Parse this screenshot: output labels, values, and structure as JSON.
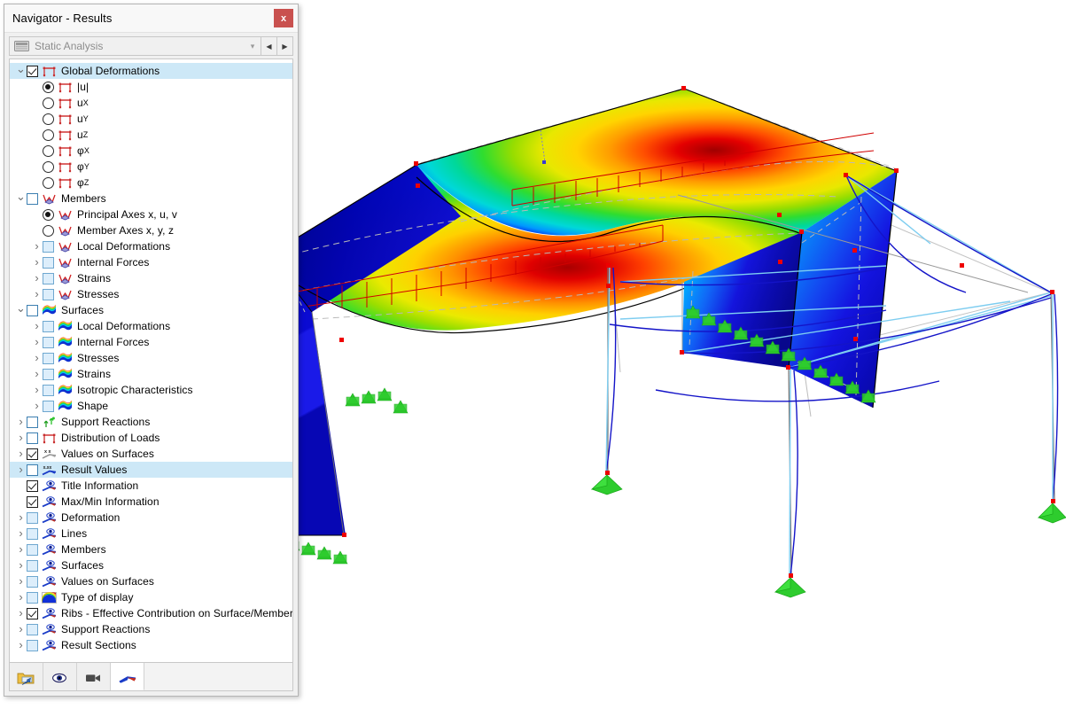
{
  "window": {
    "title": "Navigator - Results",
    "close_label": "x",
    "close_icon": "close-icon"
  },
  "combo": {
    "value": "Static Analysis",
    "icon": "analysis-type-icon",
    "dropdown_icon": "chevron-down-icon",
    "prev_label": "◀",
    "next_label": "▶"
  },
  "tree": [
    {
      "label": "Global Deformations",
      "depth": 0,
      "twisty": "expanded",
      "control": "checkbox",
      "state": "checked",
      "icon": "frame-icon",
      "selected": true
    },
    {
      "label": "|u|",
      "depth": 1,
      "twisty": "none",
      "control": "radio",
      "state": "checked",
      "icon": "frame-icon",
      "selected": false
    },
    {
      "label": "u",
      "sub": "X",
      "depth": 1,
      "twisty": "none",
      "control": "radio",
      "state": "unchecked",
      "icon": "frame-icon",
      "selected": false
    },
    {
      "label": "u",
      "sub": "Y",
      "depth": 1,
      "twisty": "none",
      "control": "radio",
      "state": "unchecked",
      "icon": "frame-icon",
      "selected": false
    },
    {
      "label": "u",
      "sub": "Z",
      "depth": 1,
      "twisty": "none",
      "control": "radio",
      "state": "unchecked",
      "icon": "frame-icon",
      "selected": false
    },
    {
      "label": "φ",
      "sub": "X",
      "depth": 1,
      "twisty": "none",
      "control": "radio",
      "state": "unchecked",
      "icon": "frame-icon",
      "selected": false
    },
    {
      "label": "φ",
      "sub": "Y",
      "depth": 1,
      "twisty": "none",
      "control": "radio",
      "state": "unchecked",
      "icon": "frame-icon",
      "selected": false
    },
    {
      "label": "φ",
      "sub": "Z",
      "depth": 1,
      "twisty": "none",
      "control": "radio",
      "state": "unchecked",
      "icon": "frame-icon",
      "selected": false
    },
    {
      "label": "Members",
      "depth": 0,
      "twisty": "expanded",
      "control": "checkbox",
      "state": "unchecked",
      "icon": "member-diagram-icon",
      "selected": false
    },
    {
      "label": "Principal Axes x, u, v",
      "depth": 1,
      "twisty": "none",
      "control": "radio",
      "state": "checked",
      "icon": "member-diagram-icon",
      "selected": false
    },
    {
      "label": "Member Axes x, y, z",
      "depth": 1,
      "twisty": "none",
      "control": "radio",
      "state": "unchecked",
      "icon": "member-diagram-icon",
      "selected": false
    },
    {
      "label": "Local Deformations",
      "depth": 1,
      "twisty": "collapsed",
      "control": "checkbox",
      "state": "light",
      "icon": "member-diagram-icon",
      "selected": false
    },
    {
      "label": "Internal Forces",
      "depth": 1,
      "twisty": "collapsed",
      "control": "checkbox",
      "state": "light",
      "icon": "member-diagram-icon",
      "selected": false
    },
    {
      "label": "Strains",
      "depth": 1,
      "twisty": "collapsed",
      "control": "checkbox",
      "state": "light",
      "icon": "member-diagram-icon",
      "selected": false
    },
    {
      "label": "Stresses",
      "depth": 1,
      "twisty": "collapsed",
      "control": "checkbox",
      "state": "light",
      "icon": "member-diagram-icon",
      "selected": false
    },
    {
      "label": "Surfaces",
      "depth": 0,
      "twisty": "expanded",
      "control": "checkbox",
      "state": "unchecked",
      "icon": "surface-contour-icon",
      "selected": false
    },
    {
      "label": "Local Deformations",
      "depth": 1,
      "twisty": "collapsed",
      "control": "checkbox",
      "state": "light",
      "icon": "surface-contour-icon",
      "selected": false
    },
    {
      "label": "Internal Forces",
      "depth": 1,
      "twisty": "collapsed",
      "control": "checkbox",
      "state": "light",
      "icon": "surface-contour-icon",
      "selected": false
    },
    {
      "label": "Stresses",
      "depth": 1,
      "twisty": "collapsed",
      "control": "checkbox",
      "state": "light",
      "icon": "surface-contour-icon",
      "selected": false
    },
    {
      "label": "Strains",
      "depth": 1,
      "twisty": "collapsed",
      "control": "checkbox",
      "state": "light",
      "icon": "surface-contour-icon",
      "selected": false
    },
    {
      "label": "Isotropic Characteristics",
      "depth": 1,
      "twisty": "collapsed",
      "control": "checkbox",
      "state": "light",
      "icon": "surface-contour-icon",
      "selected": false
    },
    {
      "label": "Shape",
      "depth": 1,
      "twisty": "collapsed",
      "control": "checkbox",
      "state": "light",
      "icon": "surface-contour-icon",
      "selected": false
    },
    {
      "label": "Support Reactions",
      "depth": 0,
      "twisty": "collapsed",
      "control": "checkbox",
      "state": "unchecked",
      "icon": "support-reaction-icon",
      "selected": false
    },
    {
      "label": "Distribution of Loads",
      "depth": 0,
      "twisty": "collapsed",
      "control": "checkbox",
      "state": "unchecked",
      "icon": "frame-icon",
      "selected": false
    },
    {
      "label": "Values on Surfaces",
      "depth": 0,
      "twisty": "collapsed",
      "control": "checkbox",
      "state": "checked",
      "icon": "values-xx-icon",
      "selected": false
    },
    {
      "label": "Result Values",
      "depth": 0,
      "twisty": "collapsed",
      "control": "checkbox",
      "state": "unchecked",
      "icon": "result-values-icon",
      "selected": true
    },
    {
      "label": "Title Information",
      "depth": 0,
      "twisty": "none",
      "control": "checkbox",
      "state": "checked",
      "icon": "display-eye-icon",
      "selected": false
    },
    {
      "label": "Max/Min Information",
      "depth": 0,
      "twisty": "none",
      "control": "checkbox",
      "state": "checked",
      "icon": "display-eye-icon",
      "selected": false
    },
    {
      "label": "Deformation",
      "depth": 0,
      "twisty": "collapsed",
      "control": "checkbox",
      "state": "light",
      "icon": "display-eye-icon",
      "selected": false
    },
    {
      "label": "Lines",
      "depth": 0,
      "twisty": "collapsed",
      "control": "checkbox",
      "state": "light",
      "icon": "display-eye-icon",
      "selected": false
    },
    {
      "label": "Members",
      "depth": 0,
      "twisty": "collapsed",
      "control": "checkbox",
      "state": "light",
      "icon": "display-eye-icon",
      "selected": false
    },
    {
      "label": "Surfaces",
      "depth": 0,
      "twisty": "collapsed",
      "control": "checkbox",
      "state": "light",
      "icon": "display-eye-icon",
      "selected": false
    },
    {
      "label": "Values on Surfaces",
      "depth": 0,
      "twisty": "collapsed",
      "control": "checkbox",
      "state": "light",
      "icon": "display-eye-icon",
      "selected": false
    },
    {
      "label": "Type of display",
      "depth": 0,
      "twisty": "collapsed",
      "control": "checkbox",
      "state": "light",
      "icon": "rainbow-icon",
      "selected": false
    },
    {
      "label": "Ribs - Effective Contribution on Surface/Member",
      "depth": 0,
      "twisty": "collapsed",
      "control": "checkbox",
      "state": "checked",
      "icon": "display-eye-icon",
      "selected": false
    },
    {
      "label": "Support Reactions",
      "depth": 0,
      "twisty": "collapsed",
      "control": "checkbox",
      "state": "light",
      "icon": "display-eye-icon",
      "selected": false
    },
    {
      "label": "Result Sections",
      "depth": 0,
      "twisty": "collapsed",
      "control": "checkbox",
      "state": "light",
      "icon": "display-eye-icon",
      "selected": false
    }
  ],
  "tabs": [
    {
      "name": "project-navigator-tab",
      "icon": "folder-arrow-icon",
      "active": false
    },
    {
      "name": "display-navigator-tab",
      "icon": "eye-icon",
      "active": false
    },
    {
      "name": "views-navigator-tab",
      "icon": "video-camera-icon",
      "active": false
    },
    {
      "name": "results-navigator-tab",
      "icon": "result-diagram-icon",
      "active": true
    }
  ],
  "colors": {
    "selection": "#cde8f7",
    "close_button": "#c9514f",
    "checkbox_border": "#3c7fb1",
    "contour_red": "#ff0000",
    "contour_blue": "#0000cd",
    "support_green": "#2ecc2e",
    "node_red": "#ee0000",
    "cable_light": "#7ecdf0",
    "cable_dark": "#1414c8"
  },
  "viewport": {
    "name": "structural-result-3d-view",
    "description": "Deformation contour plot |u| on surfaces of a cable-stayed roof structure"
  }
}
